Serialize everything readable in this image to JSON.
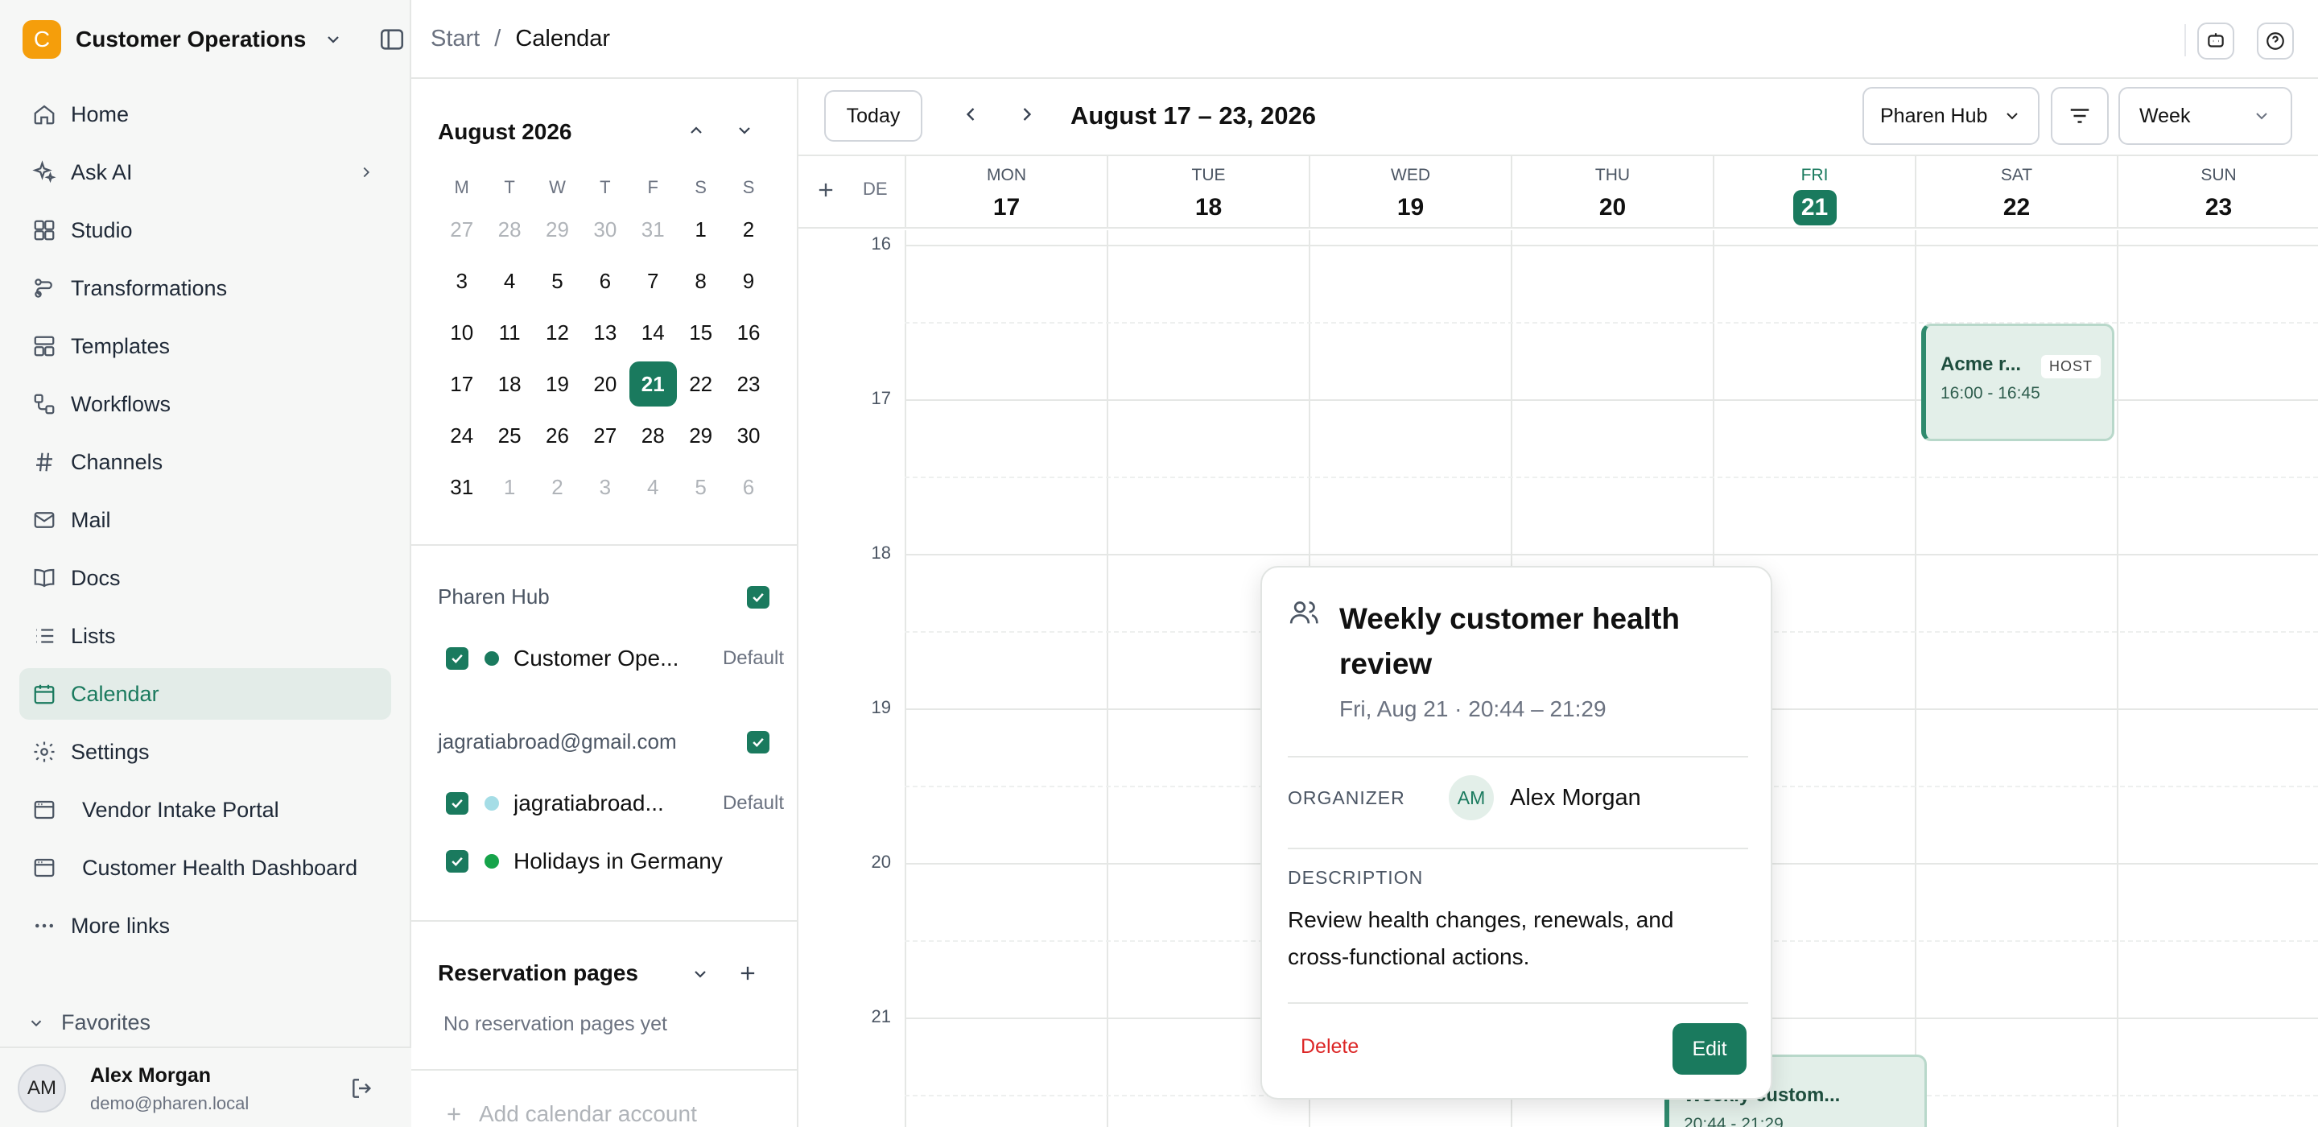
{
  "workspace": {
    "initial": "C",
    "name": "Customer Operations"
  },
  "nav": {
    "items": [
      {
        "label": "Home",
        "icon": "home-icon"
      },
      {
        "label": "Ask AI",
        "icon": "sparkles-icon"
      },
      {
        "label": "Studio",
        "icon": "grid-icon"
      },
      {
        "label": "Transformations",
        "icon": "flow-icon"
      },
      {
        "label": "Templates",
        "icon": "layout-icon"
      },
      {
        "label": "Workflows",
        "icon": "workflow-icon"
      },
      {
        "label": "Channels",
        "icon": "hash-icon"
      },
      {
        "label": "Mail",
        "icon": "mail-icon"
      },
      {
        "label": "Docs",
        "icon": "book-icon"
      },
      {
        "label": "Lists",
        "icon": "list-icon"
      },
      {
        "label": "Calendar",
        "icon": "calendar-icon"
      },
      {
        "label": "Settings",
        "icon": "gear-icon"
      }
    ],
    "links": [
      {
        "label": "Vendor Intake Portal"
      },
      {
        "label": "Customer Health Dashboard"
      }
    ],
    "more": "More links",
    "favorites": "Favorites"
  },
  "user": {
    "initials": "AM",
    "name": "Alex Morgan",
    "email": "demo@pharen.local"
  },
  "breadcrumb": {
    "start": "Start",
    "sep": "/",
    "current": "Calendar"
  },
  "mini_calendar": {
    "title": "August 2026",
    "weekdays": [
      "M",
      "T",
      "W",
      "T",
      "F",
      "S",
      "S"
    ],
    "weeks": [
      [
        [
          "27",
          1
        ],
        [
          "28",
          1
        ],
        [
          "29",
          1
        ],
        [
          "30",
          1
        ],
        [
          "31",
          1
        ],
        [
          "1",
          0
        ],
        [
          "2",
          0
        ]
      ],
      [
        [
          "3",
          0
        ],
        [
          "4",
          0
        ],
        [
          "5",
          0
        ],
        [
          "6",
          0
        ],
        [
          "7",
          0
        ],
        [
          "8",
          0
        ],
        [
          "9",
          0
        ]
      ],
      [
        [
          "10",
          0
        ],
        [
          "11",
          0
        ],
        [
          "12",
          0
        ],
        [
          "13",
          0
        ],
        [
          "14",
          0
        ],
        [
          "15",
          0
        ],
        [
          "16",
          0
        ]
      ],
      [
        [
          "17",
          0
        ],
        [
          "18",
          0
        ],
        [
          "19",
          0
        ],
        [
          "20",
          0
        ],
        [
          "21",
          2
        ],
        [
          "22",
          0
        ],
        [
          "23",
          0
        ]
      ],
      [
        [
          "24",
          0
        ],
        [
          "25",
          0
        ],
        [
          "26",
          0
        ],
        [
          "27",
          0
        ],
        [
          "28",
          0
        ],
        [
          "29",
          0
        ],
        [
          "30",
          0
        ]
      ],
      [
        [
          "31",
          0
        ],
        [
          "1",
          1
        ],
        [
          "2",
          1
        ],
        [
          "3",
          1
        ],
        [
          "4",
          1
        ],
        [
          "5",
          1
        ],
        [
          "6",
          1
        ]
      ]
    ]
  },
  "calendars": {
    "group1": "Pharen Hub",
    "cal1": {
      "name": "Customer Ope...",
      "default": "Default",
      "color": "#1a7a5e"
    },
    "group2": "jagratiabroad@gmail.com",
    "cal2": {
      "name": "jagratiabroad...",
      "default": "Default",
      "color": "#a5dde6"
    },
    "cal3": {
      "name": "Holidays in Germany",
      "color": "#16a34a"
    }
  },
  "reservations": {
    "title": "Reservation pages",
    "empty": "No reservation pages yet",
    "add_account": "Add calendar account"
  },
  "toolbar": {
    "today": "Today",
    "range": "August 17 – 23, 2026",
    "hub": "Pharen Hub",
    "view": "Week"
  },
  "week": {
    "tz": "DE",
    "days": [
      {
        "name": "MON",
        "num": "17"
      },
      {
        "name": "TUE",
        "num": "18"
      },
      {
        "name": "WED",
        "num": "19"
      },
      {
        "name": "THU",
        "num": "20"
      },
      {
        "name": "FRI",
        "num": "21",
        "today": true
      },
      {
        "name": "SAT",
        "num": "22"
      },
      {
        "name": "SUN",
        "num": "23"
      }
    ],
    "hours": [
      "16",
      "17",
      "18",
      "19",
      "20",
      "21"
    ]
  },
  "events": {
    "acme": {
      "title": "Acme r...",
      "time": "16:00 - 16:45",
      "badge": "HOST"
    },
    "weekly": {
      "title": "Weekly custom...",
      "time": "20:44 - 21:29"
    }
  },
  "popover": {
    "title": "Weekly customer health review",
    "time": "Fri, Aug 21 · 20:44 – 21:29",
    "organizer_label": "ORGANIZER",
    "organizer_initials": "AM",
    "organizer_name": "Alex Morgan",
    "description_label": "DESCRIPTION",
    "description": "Review health changes, renewals, and cross-functional actions.",
    "delete": "Delete",
    "edit": "Edit"
  },
  "colors": {
    "accent": "#1a7a5e",
    "brand": "#f59e0b",
    "danger": "#dc2626"
  }
}
